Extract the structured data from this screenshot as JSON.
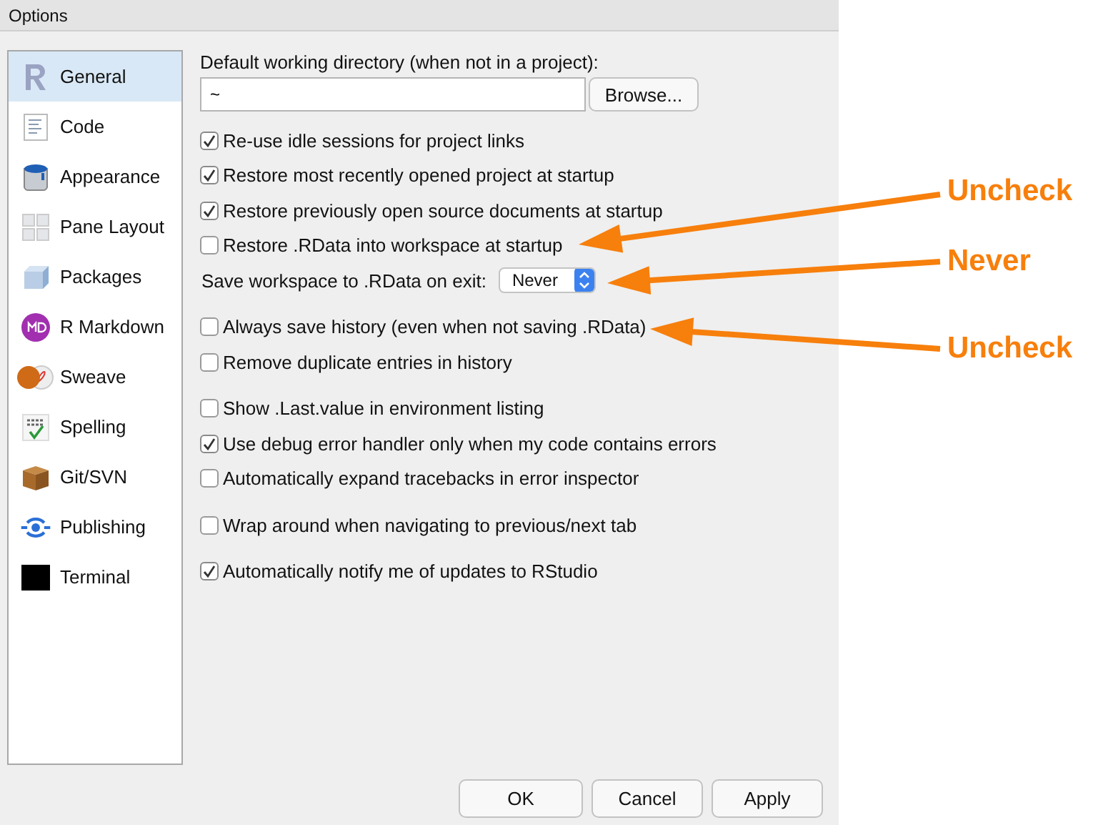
{
  "window": {
    "title": "Options"
  },
  "sidebar": {
    "items": [
      {
        "label": "General",
        "selected": true
      },
      {
        "label": "Code",
        "selected": false
      },
      {
        "label": "Appearance",
        "selected": false
      },
      {
        "label": "Pane Layout",
        "selected": false
      },
      {
        "label": "Packages",
        "selected": false
      },
      {
        "label": "R Markdown",
        "selected": false
      },
      {
        "label": "Sweave",
        "selected": false
      },
      {
        "label": "Spelling",
        "selected": false
      },
      {
        "label": "Git/SVN",
        "selected": false
      },
      {
        "label": "Publishing",
        "selected": false
      },
      {
        "label": "Terminal",
        "selected": false
      }
    ]
  },
  "working_directory": {
    "label": "Default working directory (when not in a project):",
    "value": "~",
    "button": "Browse..."
  },
  "groups": [
    [
      {
        "kind": "checkbox",
        "label": "Re-use idle sessions for project links",
        "checked": true
      },
      {
        "kind": "checkbox",
        "label": "Restore most recently opened project at startup",
        "checked": true
      },
      {
        "kind": "checkbox",
        "label": "Restore previously open source documents at startup",
        "checked": true
      },
      {
        "kind": "checkbox",
        "label": "Restore .RData into workspace at startup",
        "checked": false
      },
      {
        "kind": "select",
        "label": "Save workspace to .RData on exit:",
        "value": "Never"
      }
    ],
    [
      {
        "kind": "checkbox",
        "label": "Always save history (even when not saving .RData)",
        "checked": false
      },
      {
        "kind": "checkbox",
        "label": "Remove duplicate entries in history",
        "checked": false
      }
    ],
    [
      {
        "kind": "checkbox",
        "label": "Show .Last.value in environment listing",
        "checked": false
      },
      {
        "kind": "checkbox",
        "label": "Use debug error handler only when my code contains errors",
        "checked": true
      },
      {
        "kind": "checkbox",
        "label": "Automatically expand tracebacks in error inspector",
        "checked": false
      }
    ],
    [
      {
        "kind": "checkbox",
        "label": "Wrap around when navigating to previous/next tab",
        "checked": false
      }
    ],
    [
      {
        "kind": "checkbox",
        "label": "Automatically notify me of updates to RStudio",
        "checked": true
      }
    ]
  ],
  "buttons": [
    "OK",
    "Cancel",
    "Apply"
  ],
  "annotations": [
    "Uncheck",
    "Never",
    "Uncheck"
  ]
}
